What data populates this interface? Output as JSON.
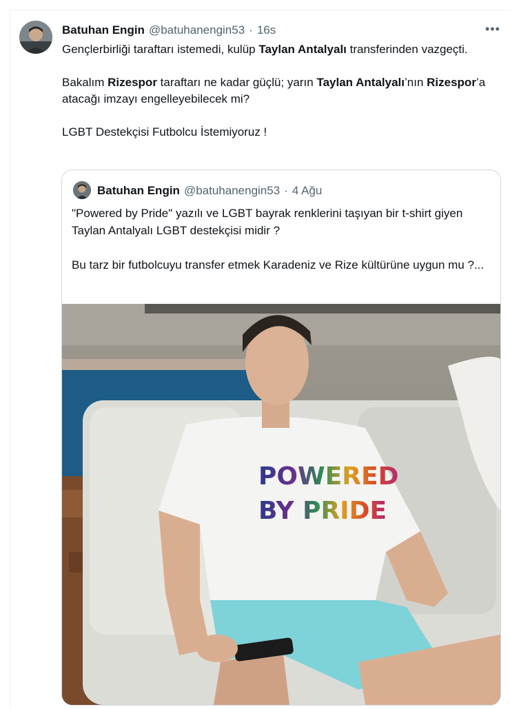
{
  "tweet": {
    "author_name": "Batuhan Engin",
    "author_handle": "@batuhanengin53",
    "separator": "·",
    "time": "16s",
    "more_icon": "more-horizontal-icon",
    "line1_pre": "Gençlerbirliği taraftarı istemedi, kulüp ",
    "line1_bold": "Taylan Antalyalı",
    "line1_post": " transferinden vazgeçti.",
    "line2_pre": "Bakalım ",
    "line2_bold1": "Rizespor",
    "line2_mid1": " taraftarı ne kadar güçlü; yarın ",
    "line2_bold2": "Taylan Antalyalı",
    "line2_mid2": "’nın ",
    "line2_bold3": "Rizespor",
    "line2_post": "’a atacağı imzayı engelleyebilecek mi?",
    "line3": "LGBT Destekçisi Futbolcu İstemiyoruz !"
  },
  "quoted_tweet": {
    "author_name": "Batuhan Engin",
    "author_handle": "@batuhanengin53",
    "separator": "·",
    "time": "4 Ağu",
    "para1": "\"Powered by Pride\" yazılı ve LGBT bayrak renklerini taşıyan bir t-shirt giyen Taylan Antalyalı LGBT destekçisi midir ?",
    "para2": "Bu tarz bir futbolcuyu transfer etmek  Karadeniz ve Rize kültürüne uygun mu ?...",
    "photo_shirt_text_line1": "POWERED",
    "photo_shirt_text_line2": "BY PRIDE"
  }
}
